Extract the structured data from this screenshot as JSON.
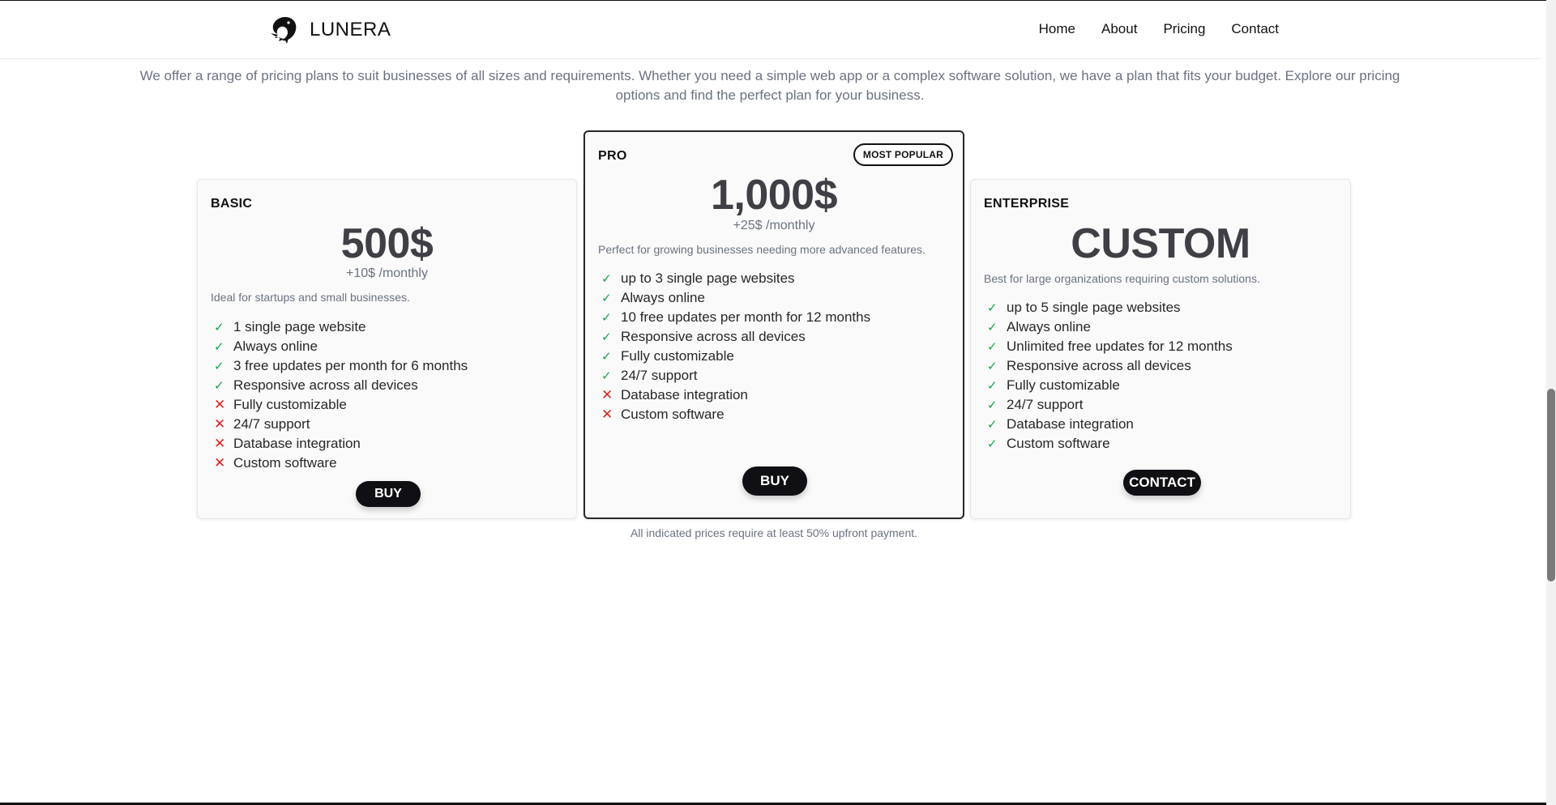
{
  "brand": {
    "name": "LUNERA"
  },
  "nav": {
    "items": [
      "Home",
      "About",
      "Pricing",
      "Contact"
    ]
  },
  "intro": "We offer a range of pricing plans to suit businesses of all sizes and requirements. Whether you need a simple web app or a complex software solution, we have a plan that fits your budget. Explore our pricing options and find the perfect plan for your business.",
  "plans": [
    {
      "name": "BASIC",
      "price": "500$",
      "monthly": "+10$ /monthly",
      "description": "Ideal for startups and small businesses.",
      "features": [
        {
          "text": "1 single page website",
          "included": true
        },
        {
          "text": "Always online",
          "included": true
        },
        {
          "text": "3 free updates per month for 6 months",
          "included": true
        },
        {
          "text": "Responsive across all devices",
          "included": true
        },
        {
          "text": "Fully customizable",
          "included": false
        },
        {
          "text": "24/7 support",
          "included": false
        },
        {
          "text": "Database integration",
          "included": false
        },
        {
          "text": "Custom software",
          "included": false
        }
      ],
      "button": "BUY"
    },
    {
      "name": "PRO",
      "badge": "MOST POPULAR",
      "price": "1,000$",
      "monthly": "+25$ /monthly",
      "description": "Perfect for growing businesses needing more advanced features.",
      "features": [
        {
          "text": "up to 3 single page websites",
          "included": true
        },
        {
          "text": "Always online",
          "included": true
        },
        {
          "text": "10 free updates per month for 12 months",
          "included": true
        },
        {
          "text": "Responsive across all devices",
          "included": true
        },
        {
          "text": "Fully customizable",
          "included": true
        },
        {
          "text": "24/7 support",
          "included": true
        },
        {
          "text": "Database integration",
          "included": false
        },
        {
          "text": "Custom software",
          "included": false
        }
      ],
      "button": "BUY"
    },
    {
      "name": "ENTERPRISE",
      "price": "CUSTOM",
      "description": "Best for large organizations requiring custom solutions.",
      "features": [
        {
          "text": "up to 5 single page websites",
          "included": true
        },
        {
          "text": "Always online",
          "included": true
        },
        {
          "text": "Unlimited free updates for 12 months",
          "included": true
        },
        {
          "text": "Responsive across all devices",
          "included": true
        },
        {
          "text": "Fully customizable",
          "included": true
        },
        {
          "text": "24/7 support",
          "included": true
        },
        {
          "text": "Database integration",
          "included": true
        },
        {
          "text": "Custom software",
          "included": true
        }
      ],
      "button": "CONTACT"
    }
  ],
  "note": "All indicated prices require at least 50% upfront payment.",
  "icons": {
    "included": "check-icon",
    "excluded": "x-icon",
    "logo": "bird-logo-icon"
  },
  "colors": {
    "check": "#16a34a",
    "cross": "#dc2626",
    "button": "#0f0f14"
  }
}
